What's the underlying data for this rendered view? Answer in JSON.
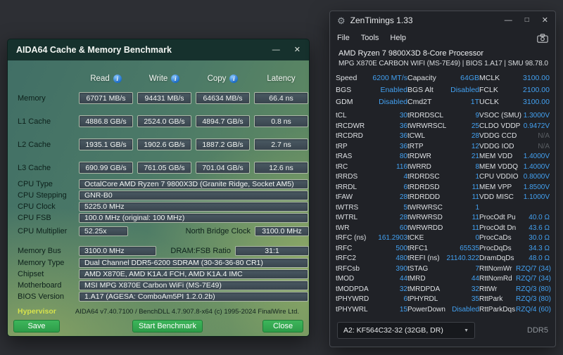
{
  "aida64": {
    "title": "AIDA64 Cache & Memory Benchmark",
    "controls": {
      "minimize": "—",
      "close": "✕"
    },
    "info_icon_glyph": "i",
    "columns": [
      "Read",
      "Write",
      "Copy",
      "Latency"
    ],
    "bench_rows": [
      {
        "label": "Memory",
        "values": [
          "67071 MB/s",
          "94431 MB/s",
          "64634 MB/s",
          "66.4 ns"
        ]
      },
      {
        "label": "L1 Cache",
        "values": [
          "4886.8 GB/s",
          "2524.0 GB/s",
          "4894.7 GB/s",
          "0.8 ns"
        ]
      },
      {
        "label": "L2 Cache",
        "values": [
          "1935.1 GB/s",
          "1902.6 GB/s",
          "1887.2 GB/s",
          "2.7 ns"
        ]
      },
      {
        "label": "L3 Cache",
        "values": [
          "690.99 GB/s",
          "761.05 GB/s",
          "701.04 GB/s",
          "12.6 ns"
        ]
      }
    ],
    "cpu_info": [
      {
        "label": "CPU Type",
        "value": "OctalCore AMD Ryzen 7 9800X3D (Granite Ridge, Socket AM5)"
      },
      {
        "label": "CPU Stepping",
        "value": "GNR-B0"
      },
      {
        "label": "CPU Clock",
        "value": "5225.0 MHz"
      },
      {
        "label": "CPU FSB",
        "value": "100.0 MHz (original: 100 MHz)"
      }
    ],
    "multiplier_row": {
      "label": "CPU Multiplier",
      "value": "52.25x",
      "label2": "North Bridge Clock",
      "value2": "3100.0 MHz"
    },
    "membus_row": {
      "label": "Memory Bus",
      "value": "3100.0 MHz",
      "label2": "DRAM:FSB Ratio",
      "value2": "31:1"
    },
    "board_info": [
      {
        "label": "Memory Type",
        "value": "Dual Channel DDR5-6200 SDRAM (30-36-36-80 CR1)"
      },
      {
        "label": "Chipset",
        "value": "AMD X870E, AMD K1A.4 FCH, AMD K1A.4 IMC"
      },
      {
        "label": "Motherboard",
        "value": "MSI MPG X870E Carbon WiFi (MS-7E49)"
      },
      {
        "label": "BIOS Version",
        "value": "1.A17  (AGESA: ComboAm5PI 1.2.0.2b)"
      }
    ],
    "footer_left": "Hypervisor",
    "footer_right": "AIDA64 v7.40.7100 / BenchDLL 4.7.907.8-x64  (c) 1995-2024 FinalWire Ltd.",
    "buttons": [
      {
        "id": "save",
        "label": "Save"
      },
      {
        "id": "start",
        "label": "Start Benchmark"
      },
      {
        "id": "close",
        "label": "Close"
      }
    ],
    "colors": {
      "button_green": "#35ab52",
      "hypervisor_yellow": "#d6e24c"
    }
  },
  "zentimings": {
    "title": "ZenTimings 1.33",
    "controls": {
      "minimize": "—",
      "maximize": "□",
      "close": "✕"
    },
    "app_icon_glyph": "⚙",
    "caret_glyph": "▼",
    "menu": [
      "File",
      "Tools",
      "Help"
    ],
    "cpu_name": "AMD Ryzen 7 9800X3D 8-Core Processor",
    "board_line": "MPG X870E CARBON WIFI (MS-7E49) | BIOS 1.A17 | SMU 98.78.0",
    "info_pairs": [
      [
        {
          "l": "Speed",
          "v": "6200 MT/s"
        },
        {
          "l": "Capacity",
          "v": "64GB"
        },
        {
          "l": "MCLK",
          "v": "3100.00"
        }
      ],
      [
        {
          "l": "BGS",
          "v": "Enabled"
        },
        {
          "l": "BGS Alt",
          "v": "Disabled"
        },
        {
          "l": "FCLK",
          "v": "2100.00"
        }
      ],
      [
        {
          "l": "GDM",
          "v": "Disabled"
        },
        {
          "l": "Cmd2T",
          "v": "1T"
        },
        {
          "l": "UCLK",
          "v": "3100.00"
        }
      ]
    ],
    "timing_rows": [
      [
        {
          "l": "tCL",
          "v": "30"
        },
        {
          "l": "tRDRDSCL",
          "v": "9"
        },
        {
          "l": "VSOC (SMU)",
          "v": "1.3000V"
        }
      ],
      [
        {
          "l": "tRCDWR",
          "v": "36"
        },
        {
          "l": "tWRWRSCL",
          "v": "25"
        },
        {
          "l": "CLDO VDDP",
          "v": "0.9472V"
        }
      ],
      [
        {
          "l": "tRCDRD",
          "v": "36"
        },
        {
          "l": "tCWL",
          "v": "28"
        },
        {
          "l": "VDDG CCD",
          "v": "N/A"
        }
      ],
      [
        {
          "l": "tRP",
          "v": "36"
        },
        {
          "l": "tRTP",
          "v": "12"
        },
        {
          "l": "VDDG IOD",
          "v": "N/A"
        }
      ],
      [
        {
          "l": "tRAS",
          "v": "80"
        },
        {
          "l": "tRDWR",
          "v": "21"
        },
        {
          "l": "MEM VDD",
          "v": "1.4000V"
        }
      ],
      [
        {
          "l": "tRC",
          "v": "116"
        },
        {
          "l": "tWRRD",
          "v": "8"
        },
        {
          "l": "MEM VDDQ",
          "v": "1.4000V"
        }
      ],
      [
        {
          "l": "tRRDS",
          "v": "4"
        },
        {
          "l": "tRDRDSC",
          "v": "1"
        },
        {
          "l": "CPU VDDIO",
          "v": "0.8000V"
        }
      ],
      [
        {
          "l": "tRRDL",
          "v": "6"
        },
        {
          "l": "tRDRDSD",
          "v": "11"
        },
        {
          "l": "MEM VPP",
          "v": "1.8500V"
        }
      ],
      [
        {
          "l": "tFAW",
          "v": "28"
        },
        {
          "l": "tRDRDDD",
          "v": "11"
        },
        {
          "l": "VDD MISC",
          "v": "1.1000V"
        }
      ],
      [
        {
          "l": "tWTRS",
          "v": "5"
        },
        {
          "l": "tWRWRSC",
          "v": "1"
        },
        {
          "l": "",
          "v": ""
        }
      ],
      [
        {
          "l": "tWTRL",
          "v": "28"
        },
        {
          "l": "tWRWRSD",
          "v": "11"
        },
        {
          "l": "ProcOdt Pu",
          "v": "40.0 Ω"
        }
      ],
      [
        {
          "l": "tWR",
          "v": "60"
        },
        {
          "l": "tWRWRDD",
          "v": "11"
        },
        {
          "l": "ProcOdt Dn",
          "v": "43.6 Ω"
        }
      ],
      [
        {
          "l": "tRFC (ns)",
          "v": "161.2903"
        },
        {
          "l": "tCKE",
          "v": "0"
        },
        {
          "l": "ProcCaDs",
          "v": "30.0 Ω"
        }
      ],
      [
        {
          "l": "tRFC",
          "v": "500"
        },
        {
          "l": "tRFC1",
          "v": "65535"
        },
        {
          "l": "ProcDqDs",
          "v": "34.3 Ω"
        }
      ],
      [
        {
          "l": "tRFC2",
          "v": "480"
        },
        {
          "l": "tREFI (ns)",
          "v": "21140.322"
        },
        {
          "l": "DramDqDs",
          "v": "48.0 Ω"
        }
      ],
      [
        {
          "l": "tRFCsb",
          "v": "390"
        },
        {
          "l": "tSTAG",
          "v": "7"
        },
        {
          "l": "RttNomWr",
          "v": "RZQ/7 (34)"
        }
      ],
      [
        {
          "l": "tMOD",
          "v": "44"
        },
        {
          "l": "tMRD",
          "v": "44"
        },
        {
          "l": "RttNomRd",
          "v": "RZQ/7 (34)"
        }
      ],
      [
        {
          "l": "tMODPDA",
          "v": "32"
        },
        {
          "l": "tMRDPDA",
          "v": "32"
        },
        {
          "l": "RttWr",
          "v": "RZQ/3 (80)"
        }
      ],
      [
        {
          "l": "tPHYWRD",
          "v": "6"
        },
        {
          "l": "tPHYRDL",
          "v": "35"
        },
        {
          "l": "RttPark",
          "v": "RZQ/3 (80)"
        }
      ],
      [
        {
          "l": "tPHYWRL",
          "v": "15"
        },
        {
          "l": "PowerDown",
          "v": "Disabled"
        },
        {
          "l": "RttParkDqs",
          "v": "RZQ/4 (60)"
        }
      ]
    ],
    "dimm_select": "A2: KF564C32-32 (32GB, DR)",
    "mem_standard": "DDR5",
    "colors": {
      "value_blue": "#42a0f0",
      "na_gray": "#5a5e63"
    }
  }
}
